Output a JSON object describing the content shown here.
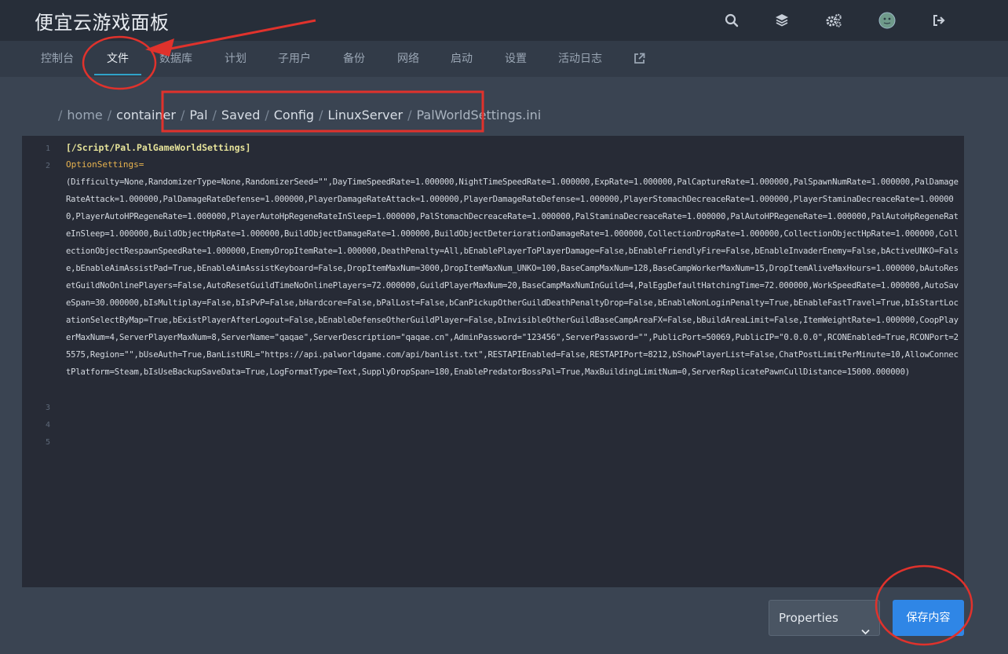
{
  "app": {
    "title": "便宜云游戏面板"
  },
  "top_icons": [
    "search-icon",
    "layers-icon",
    "settings-icon",
    "avatar",
    "logout-icon"
  ],
  "nav": {
    "items": [
      {
        "label": "控制台"
      },
      {
        "label": "文件",
        "active": true
      },
      {
        "label": "数据库"
      },
      {
        "label": "计划"
      },
      {
        "label": "子用户"
      },
      {
        "label": "备份"
      },
      {
        "label": "网络"
      },
      {
        "label": "启动"
      },
      {
        "label": "设置"
      },
      {
        "label": "活动日志"
      }
    ],
    "external_icon": "external-link-icon"
  },
  "breadcrumb": [
    "home",
    "container",
    "Pal",
    "Saved",
    "Config",
    "LinuxServer",
    "PalWorldSettings.ini"
  ],
  "breadcrumb_separator": "/",
  "editor": {
    "line_numbers": [
      "1",
      "2",
      "3",
      "4",
      "5"
    ],
    "line1": "[/Script/Pal.PalGameWorldSettings]",
    "line2_key": "OptionSettings=",
    "line2_value": "(Difficulty=None,RandomizerType=None,RandomizerSeed=\"\",DayTimeSpeedRate=1.000000,NightTimeSpeedRate=1.000000,ExpRate=1.000000,PalCaptureRate=1.000000,PalSpawnNumRate=1.000000,PalDamageRateAttack=1.000000,PalDamageRateDefense=1.000000,PlayerDamageRateAttack=1.000000,PlayerDamageRateDefense=1.000000,PlayerStomachDecreaceRate=1.000000,PlayerStaminaDecreaceRate=1.000000,PlayerAutoHPRegeneRate=1.000000,PlayerAutoHpRegeneRateInSleep=1.000000,PalStomachDecreaceRate=1.000000,PalStaminaDecreaceRate=1.000000,PalAutoHPRegeneRate=1.000000,PalAutoHpRegeneRateInSleep=1.000000,BuildObjectHpRate=1.000000,BuildObjectDamageRate=1.000000,BuildObjectDeteriorationDamageRate=1.000000,CollectionDropRate=1.000000,CollectionObjectHpRate=1.000000,CollectionObjectRespawnSpeedRate=1.000000,EnemyDropItemRate=1.000000,DeathPenalty=All,bEnablePlayerToPlayerDamage=False,bEnableFriendlyFire=False,bEnableInvaderEnemy=False,bActiveUNKO=False,bEnableAimAssistPad=True,bEnableAimAssistKeyboard=False,DropItemMaxNum=3000,DropItemMaxNum_UNKO=100,BaseCampMaxNum=128,BaseCampWorkerMaxNum=15,DropItemAliveMaxHours=1.000000,bAutoResetGuildNoOnlinePlayers=False,AutoResetGuildTimeNoOnlinePlayers=72.000000,GuildPlayerMaxNum=20,BaseCampMaxNumInGuild=4,PalEggDefaultHatchingTime=72.000000,WorkSpeedRate=1.000000,AutoSaveSpan=30.000000,bIsMultiplay=False,bIsPvP=False,bHardcore=False,bPalLost=False,bCanPickupOtherGuildDeathPenaltyDrop=False,bEnableNonLoginPenalty=True,bEnableFastTravel=True,bIsStartLocationSelectByMap=True,bExistPlayerAfterLogout=False,bEnableDefenseOtherGuildPlayer=False,bInvisibleOtherGuildBaseCampAreaFX=False,bBuildAreaLimit=False,ItemWeightRate=1.000000,CoopPlayerMaxNum=4,ServerPlayerMaxNum=8,ServerName=\"qaqae\",ServerDescription=\"qaqae.cn\",AdminPassword=\"123456\",ServerPassword=\"\",PublicPort=50069,PublicIP=\"0.0.0.0\",RCONEnabled=True,RCONPort=25575,Region=\"\",bUseAuth=True,BanListURL=\"https://api.palworldgame.com/api/banlist.txt\",RESTAPIEnabled=False,RESTAPIPort=8212,bShowPlayerList=False,ChatPostLimitPerMinute=10,AllowConnectPlatform=Steam,bIsUseBackupSaveData=True,LogFormatType=Text,SupplyDropSpan=180,EnablePredatorBossPal=True,MaxBuildingLimitNum=0,ServerReplicatePawnCullDistance=15000.000000)"
  },
  "footer": {
    "mode_select": "Properties",
    "save_label": "保存内容"
  },
  "colors": {
    "accent": "#2fa3c8",
    "save_button": "#2f86e6",
    "annotation_red": "#e0322c"
  }
}
